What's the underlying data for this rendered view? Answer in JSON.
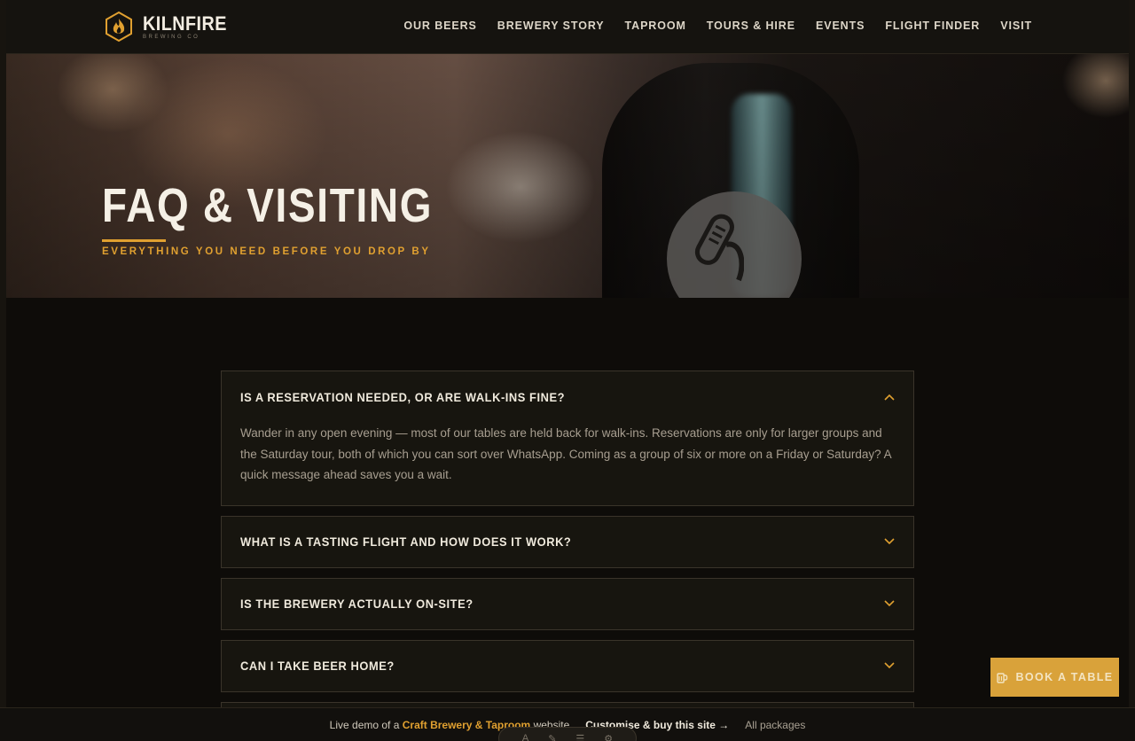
{
  "brand": {
    "name": "KILNFIRE",
    "tagline": "BREWING CO"
  },
  "nav": [
    "OUR BEERS",
    "BREWERY STORY",
    "TAPROOM",
    "TOURS & HIRE",
    "EVENTS",
    "FLIGHT FINDER",
    "VISIT"
  ],
  "hero": {
    "title": "FAQ & VISITING",
    "subtitle": "EVERYTHING YOU NEED BEFORE YOU DROP BY"
  },
  "faq": [
    {
      "question": "IS A RESERVATION NEEDED, OR ARE WALK-INS FINE?",
      "answer": "Wander in any open evening — most of our tables are held back for walk-ins. Reservations are only for larger groups and the Saturday tour, both of which you can sort over WhatsApp. Coming as a group of six or more on a Friday or Saturday? A quick message ahead saves you a wait.",
      "open": true
    },
    {
      "question": "WHAT IS A TASTING FLIGHT AND HOW DOES IT WORK?",
      "open": false
    },
    {
      "question": "IS THE BREWERY ACTUALLY ON-SITE?",
      "open": false
    },
    {
      "question": "CAN I TAKE BEER HOME?",
      "open": false
    }
  ],
  "book_button": "BOOK A TABLE",
  "bottom_bar": {
    "prefix": "Live demo of a",
    "highlight": "Craft Brewery & Taproom",
    "suffix": "website",
    "cta": "Customise & buy this site →",
    "packages": "All packages"
  },
  "colors": {
    "accent": "#e0a030",
    "background": "#0e0c09",
    "panel": "#17150f"
  }
}
